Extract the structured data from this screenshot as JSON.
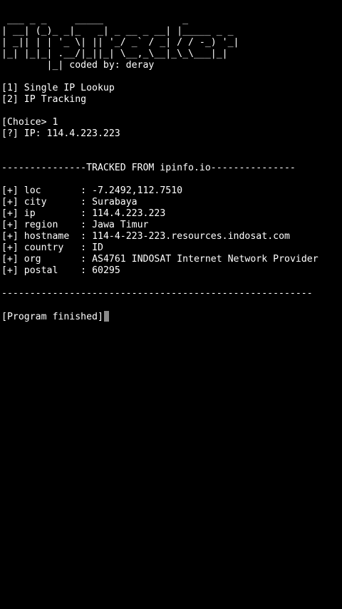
{
  "banner": {
    "lines": [
      " ___ _ _     _____              _",
      "| __| (_)_ _|_   _| _ __ _ __| |_____ _ _",
      "| _|| | | '_ \\| || '_/ _` / _| / / -_) '_|",
      "|_| |_|_| .__/|_||_| \\__,_\\__|_\\_\\___|_|",
      "        |_| coded by: deray"
    ]
  },
  "menu": {
    "items": [
      "[1] Single IP Lookup",
      "[2] IP Tracking"
    ]
  },
  "prompt": {
    "choice_line": "[Choice> 1",
    "ip_line": "[?] IP: 114.4.223.223"
  },
  "header_line": "---------------TRACKED FROM ipinfo.io---------------",
  "results": [
    {
      "prefix": "[+]",
      "key": "loc",
      "value": "-7.2492,112.7510"
    },
    {
      "prefix": "[+]",
      "key": "city",
      "value": "Surabaya"
    },
    {
      "prefix": "[+]",
      "key": "ip",
      "value": "114.4.223.223"
    },
    {
      "prefix": "[+]",
      "key": "region",
      "value": "Jawa Timur"
    },
    {
      "prefix": "[+]",
      "key": "hostname",
      "value": "114-4-223-223.resources.indosat.com"
    },
    {
      "prefix": "[+]",
      "key": "country",
      "value": "ID"
    },
    {
      "prefix": "[+]",
      "key": "org",
      "value": "AS4761 INDOSAT Internet Network Provider"
    },
    {
      "prefix": "[+]",
      "key": "postal",
      "value": "60295"
    }
  ],
  "footer_line": "-------------------------------------------------------",
  "finished_text": "[Program finished]",
  "colors": {
    "background": "#000000",
    "foreground": "#ffffff",
    "cursor": "#8a8a8a"
  }
}
